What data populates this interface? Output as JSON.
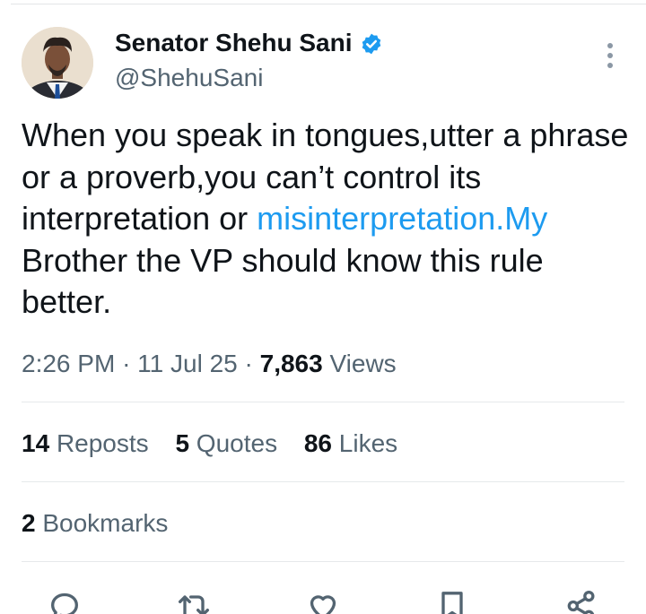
{
  "author": {
    "name": "Senator Shehu Sani",
    "handle": "@ShehuSani",
    "verified": true,
    "avatar_icon": "avatar"
  },
  "tweet": {
    "text_before_link": "When you speak in tongues,utter a phrase or a proverb,you can’t control its interpretation or ",
    "link_text": "misinterpretation.My",
    "text_after_link": " Brother the VP should know this rule better."
  },
  "meta": {
    "time": "2:26 PM",
    "separator": "·",
    "date": "11 Jul 25",
    "views_count": "7,863",
    "views_label": "Views"
  },
  "stats": {
    "reposts": {
      "count": "14",
      "label": "Reposts"
    },
    "quotes": {
      "count": "5",
      "label": "Quotes"
    },
    "likes": {
      "count": "86",
      "label": "Likes"
    },
    "bookmarks": {
      "count": "2",
      "label": "Bookmarks"
    }
  },
  "actions": [
    "reply-icon",
    "retweet-icon",
    "like-icon",
    "bookmark-icon",
    "share-icon"
  ],
  "colors": {
    "link": "#1d9bf0",
    "secondary_text": "#536471",
    "primary_text": "#0f1419",
    "verified": "#1d9bf0"
  }
}
